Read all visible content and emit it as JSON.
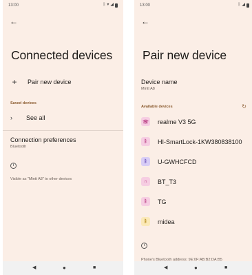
{
  "left": {
    "status_time": "13:00",
    "title": "Connected devices",
    "pair_new_label": "Pair new device",
    "saved_section": "Saved devices",
    "see_all_label": "See all",
    "pref_title": "Connection preferences",
    "pref_subtitle": "Bluetooth",
    "info_text": "Visible as \"Mintt A8\" to other devices"
  },
  "right": {
    "status_time": "13:00",
    "title": "Pair new device",
    "device_name_label": "Device name",
    "device_name_value": "Mintt A8",
    "available_section": "Available devices",
    "devices": [
      {
        "name": "realme V3 5G",
        "icon": "phone-icon",
        "bg": "#f6cde2",
        "fg": "#b3307a"
      },
      {
        "name": "HI-SmartLock-1KW380838100",
        "icon": "bluetooth-icon",
        "bg": "#f6cde2",
        "fg": "#b3307a"
      },
      {
        "name": "U-GWHCFCD",
        "icon": "bluetooth-icon",
        "bg": "#d8cdf6",
        "fg": "#5a3fb0"
      },
      {
        "name": "BT_T3",
        "icon": "headphones-icon",
        "bg": "#f6cde2",
        "fg": "#b3307a"
      },
      {
        "name": "TG",
        "icon": "bluetooth-icon",
        "bg": "#f6cde2",
        "fg": "#b3307a"
      },
      {
        "name": "midea",
        "icon": "bluetooth-icon",
        "bg": "#fbe9b8",
        "fg": "#a87a00"
      }
    ],
    "address_text": "Phone's Bluetooth address: 9E:0F:AB:B2:DA:B5"
  },
  "colors": {
    "background": "#fbeee6",
    "accent": "#8a5a2e"
  }
}
